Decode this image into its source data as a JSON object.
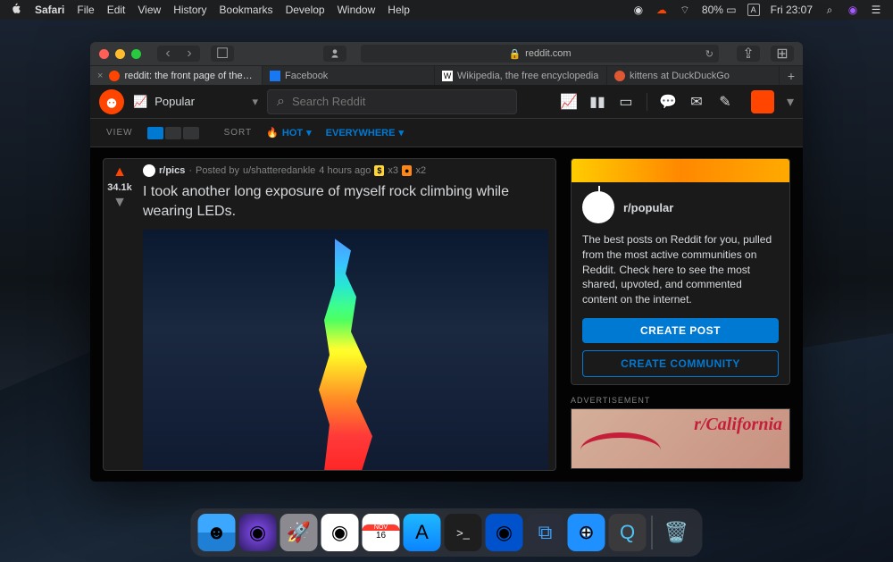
{
  "menubar": {
    "app": "Safari",
    "items": [
      "File",
      "Edit",
      "View",
      "History",
      "Bookmarks",
      "Develop",
      "Window",
      "Help"
    ],
    "battery": "80%",
    "day": "Fri",
    "time": "23:07"
  },
  "browser": {
    "url": "reddit.com",
    "tabs": [
      {
        "label": "reddit: the front page of the internet",
        "active": true
      },
      {
        "label": "Facebook",
        "active": false
      },
      {
        "label": "Wikipedia, the free encyclopedia",
        "active": false
      },
      {
        "label": "kittens at DuckDuckGo",
        "active": false
      }
    ]
  },
  "reddit": {
    "feed": "Popular",
    "search_placeholder": "Search Reddit",
    "filters": {
      "view": "VIEW",
      "sort": "SORT",
      "hot": "HOT",
      "where": "EVERYWHERE"
    },
    "post": {
      "subreddit": "r/pics",
      "author": "u/shatteredankle",
      "time": "4 hours ago",
      "awards": "x3",
      "awards2": "x2",
      "score": "34.1k",
      "title": "I took another long exposure of myself rock climbing while wearing LEDs.",
      "posted_by": "Posted by"
    },
    "sidebar": {
      "community": "r/popular",
      "desc": "The best posts on Reddit for you, pulled from the most active communities on Reddit. Check here to see the most shared, upvoted, and commented content on the internet.",
      "create_post": "CREATE POST",
      "create_community": "CREATE COMMUNITY",
      "ad_label": "ADVERTISEMENT",
      "ad_text": "r/California"
    }
  }
}
